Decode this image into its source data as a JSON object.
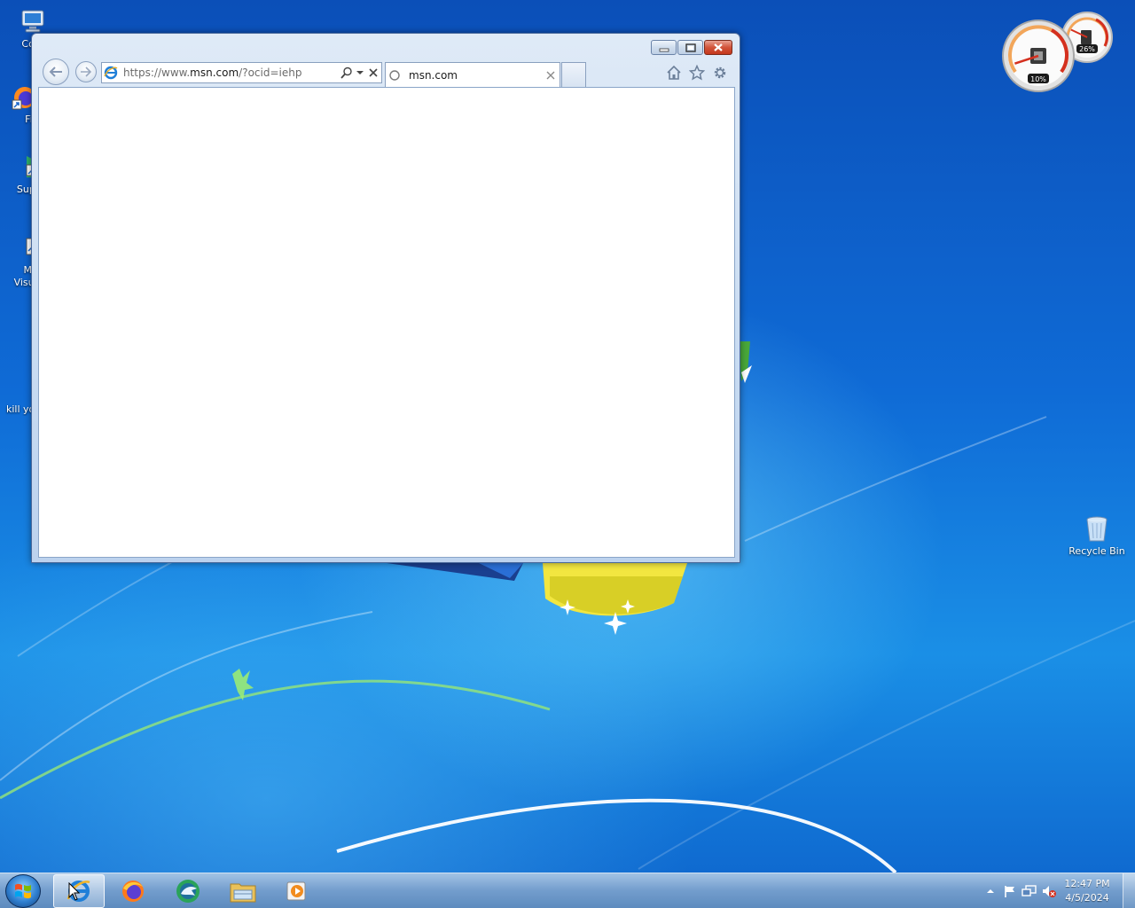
{
  "desktop": {
    "icons": [
      {
        "label": "Com",
        "icon": "computer-icon"
      },
      {
        "label": "Fire",
        "icon": "firefox-shortcut-icon"
      },
      {
        "label": "Super",
        "icon": "shortcut-icon"
      },
      {
        "label": "Micr",
        "label2": "Visual",
        "icon": "shortcut-icon"
      },
      {
        "label": "kill yo",
        "icon": "text-file-icon"
      }
    ],
    "recycle_bin": {
      "label": "Recycle Bin",
      "icon": "recycle-bin-icon"
    }
  },
  "gadget": {
    "cpu_percent_label": "10%",
    "memory_percent_label": "26%",
    "cpu_level": 0.1,
    "memory_level": 0.26
  },
  "browser": {
    "address": {
      "prefix": "https://www.",
      "domain": "msn.com",
      "suffix": "/?ocid=iehp"
    },
    "tab": {
      "title": "msn.com"
    },
    "icons": {
      "back": "back-arrow-icon",
      "forward": "forward-arrow-icon",
      "home": "home-icon",
      "favorites": "star-icon",
      "tools": "gear-icon",
      "search": "search-icon",
      "stop": "close-icon"
    }
  },
  "taskbar": {
    "items": [
      {
        "name": "internet-explorer",
        "icon": "ie-icon",
        "active": true
      },
      {
        "name": "firefox",
        "icon": "firefox-icon",
        "active": false
      },
      {
        "name": "app-green",
        "icon": "bird-app-icon",
        "active": false
      },
      {
        "name": "file-explorer",
        "icon": "folder-icon",
        "active": false
      },
      {
        "name": "media-player",
        "icon": "media-player-icon",
        "active": false
      }
    ],
    "clock": {
      "time": "12:47 PM",
      "date": "4/5/2024"
    }
  },
  "colors": {
    "accent": "#1a66c9",
    "close_button": "#c4371c",
    "ie_blue": "#1f7fd8"
  }
}
